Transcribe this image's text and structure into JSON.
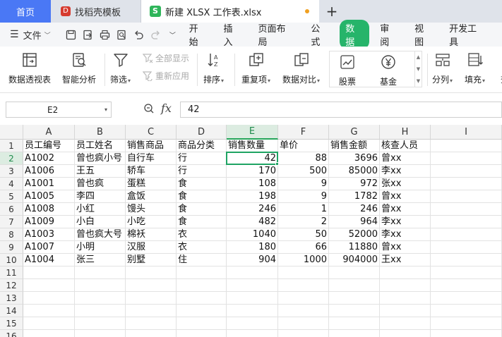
{
  "tabs": {
    "home": "首页",
    "daoke": "找稻壳模板",
    "file": "新建 XLSX 工作表.xlsx",
    "add": "+"
  },
  "menu": {
    "file_label": "文件",
    "tabs": [
      "开始",
      "插入",
      "页面布局",
      "公式",
      "数据",
      "审阅",
      "视图",
      "开发工具"
    ],
    "active_tab": "数据"
  },
  "ribbon": {
    "pivot": "数据透视表",
    "smart_analysis": "智能分析",
    "filter": "筛选",
    "show_all": "全部显示",
    "reapply": "重新应用",
    "sort": "排序",
    "duplicates": "重复项",
    "compare": "数据对比",
    "stock": "股票",
    "fund": "基金",
    "split": "分列",
    "fill": "填充",
    "find": "查"
  },
  "formula_bar": {
    "name_box": "E2",
    "fx": "fx",
    "value": "42"
  },
  "sheet": {
    "columns": [
      "A",
      "B",
      "C",
      "D",
      "E",
      "F",
      "G",
      "H",
      "I"
    ],
    "selected_column": "E",
    "selected_row": 2,
    "row_numbers": [
      1,
      2,
      3,
      4,
      5,
      6,
      7,
      8,
      9,
      10,
      11,
      12,
      13,
      14,
      15,
      16
    ],
    "header": [
      "员工编号",
      "员工姓名",
      "销售商品",
      "商品分类",
      "销售数量",
      "单价",
      "销售金额",
      "核查人员"
    ],
    "rows": [
      [
        "A1002",
        "曾也疯小号",
        "自行车",
        "行",
        "42",
        "88",
        "3696",
        "曾xx"
      ],
      [
        "A1006",
        "王五",
        "轿车",
        "行",
        "170",
        "500",
        "85000",
        "李xx"
      ],
      [
        "A1001",
        "曾也疯",
        "蛋糕",
        "食",
        "108",
        "9",
        "972",
        "张xx"
      ],
      [
        "A1005",
        "李四",
        "盒饭",
        "食",
        "198",
        "9",
        "1782",
        "曾xx"
      ],
      [
        "A1008",
        "小红",
        "馒头",
        "食",
        "246",
        "1",
        "246",
        "曾xx"
      ],
      [
        "A1009",
        "小白",
        "小吃",
        "食",
        "482",
        "2",
        "964",
        "李xx"
      ],
      [
        "A1003",
        "曾也疯大号",
        "棉袄",
        "衣",
        "1040",
        "50",
        "52000",
        "李xx"
      ],
      [
        "A1007",
        "小明",
        "汉服",
        "衣",
        "180",
        "66",
        "11880",
        "曾xx"
      ],
      [
        "A1004",
        "张三",
        "别墅",
        "住",
        "904",
        "1000",
        "904000",
        "王xx"
      ]
    ]
  },
  "colors": {
    "accent_green": "#26b46a",
    "home_tab_blue": "#4a78f5",
    "selection_green": "#1fa463"
  }
}
